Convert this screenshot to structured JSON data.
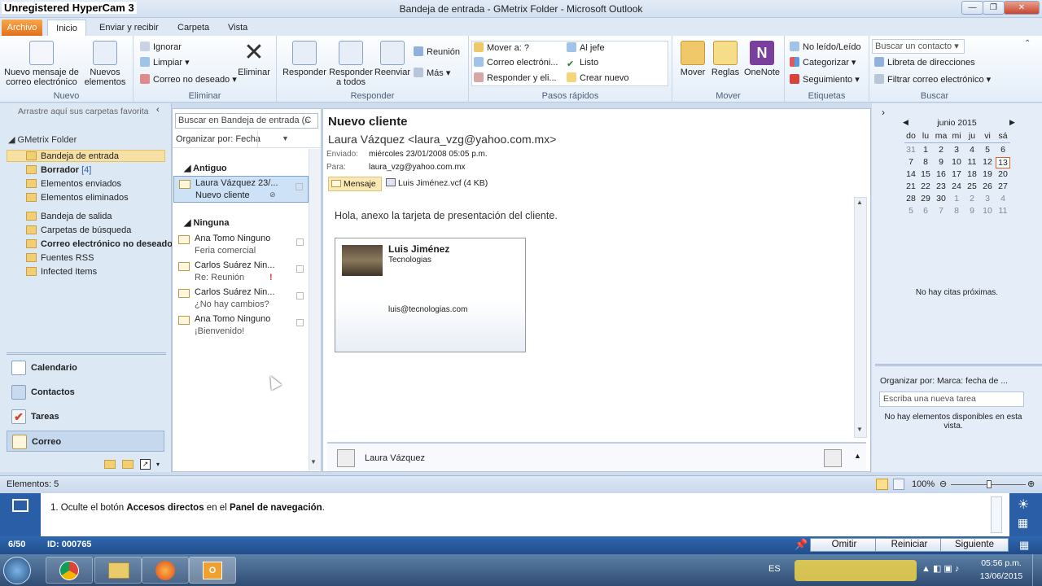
{
  "recorder_watermark": "Unregistered HyperCam 3",
  "window": {
    "title": "Bandeja de entrada - GMetrix Folder  -  Microsoft Outlook",
    "minimize": "—",
    "restore": "❐",
    "close": "✕"
  },
  "ribbon_tabs": [
    "Archivo",
    "Inicio",
    "Enviar y recibir",
    "Carpeta",
    "Vista"
  ],
  "ribbon": {
    "nuevo": {
      "label": "Nuevo",
      "new_mail": "Nuevo mensaje de correo electrónico",
      "new_items": "Nuevos elementos"
    },
    "eliminar": {
      "label": "Eliminar",
      "ignore": "Ignorar",
      "clean": "Limpiar",
      "junk": "Correo no deseado",
      "delete": "Eliminar"
    },
    "responder": {
      "label": "Responder",
      "reply": "Responder",
      "reply_all": "Responder a todos",
      "forward": "Reenviar",
      "meeting": "Reunión",
      "more": "Más"
    },
    "pasos": {
      "label": "Pasos rápidos",
      "move_to": "Mover a: ?",
      "email": "Correo electróni...",
      "reply_del": "Responder y eli...",
      "to_boss": "Al jefe",
      "done": "Listo",
      "create": "Crear nuevo"
    },
    "mover": {
      "label": "Mover",
      "move": "Mover",
      "rules": "Reglas",
      "onenote": "OneNote"
    },
    "etiquetas": {
      "label": "Etiquetas",
      "unread": "No leído/Leído",
      "categorize": "Categorizar",
      "followup": "Seguimiento"
    },
    "buscar": {
      "label": "Buscar",
      "contact_search": "Buscar un contacto",
      "address_book": "Libreta de direcciones",
      "filter": "Filtrar correo electrónico"
    }
  },
  "nav": {
    "favorites_hint": "Arrastre aquí sus carpetas favorita",
    "root": "GMetrix Folder",
    "folders": [
      "Bandeja de entrada",
      "Borrador",
      "Elementos enviados",
      "Elementos eliminados"
    ],
    "drafts_count": "[4]",
    "folders2": [
      "Bandeja de salida",
      "Carpetas de búsqueda",
      "Correo electrónico no deseado",
      "Fuentes RSS",
      "Infected Items"
    ],
    "bottom": [
      "Calendario",
      "Contactos",
      "Tareas",
      "Correo"
    ]
  },
  "list": {
    "search_placeholder": "Buscar en Bandeja de entrada (C",
    "arrange_by": "Organizar por: Fecha",
    "group_old": "Antiguo",
    "group_none": "Ninguna",
    "old_item": {
      "from": "Laura Vázquez 23/...",
      "subject": "Nuevo cliente"
    },
    "items": [
      {
        "from": "Ana Tomo  Ninguno",
        "subject": "Feria comercial"
      },
      {
        "from": "Carlos Suárez  Nin...",
        "subject": "Re: Reunión"
      },
      {
        "from": "Carlos Suárez  Nin...",
        "subject": "¿No hay cambios?"
      },
      {
        "from": "Ana Tomo  Ninguno",
        "subject": "¡Bienvenido!"
      }
    ]
  },
  "message": {
    "subject": "Nuevo cliente",
    "sender": "Laura Vázquez <laura_vzg@yahoo.com.mx>",
    "sent_label": "Enviado:",
    "sent_value": "miércoles 23/01/2008 05:05 p.m.",
    "to_label": "Para:",
    "to_value": "laura_vzg@yahoo.com.mx",
    "tab_message": "Mensaje",
    "attachment": "Luis Jiménez.vcf (4 KB)",
    "body": "Hola, anexo la tarjeta de presentación del cliente.",
    "card": {
      "name": "Luis Jiménez",
      "company": "Tecnologias",
      "email": "luis@tecnologias.com"
    },
    "people": "Laura Vázquez"
  },
  "todo": {
    "month": "junio 2015",
    "weekdays": [
      "do",
      "lu",
      "ma",
      "mi",
      "ju",
      "vi",
      "sá"
    ],
    "weeks": [
      [
        "31",
        "1",
        "2",
        "3",
        "4",
        "5",
        "6"
      ],
      [
        "7",
        "8",
        "9",
        "10",
        "11",
        "12",
        "13"
      ],
      [
        "14",
        "15",
        "16",
        "17",
        "18",
        "19",
        "20"
      ],
      [
        "21",
        "22",
        "23",
        "24",
        "25",
        "26",
        "27"
      ],
      [
        "28",
        "29",
        "30",
        "1",
        "2",
        "3",
        "4"
      ],
      [
        "5",
        "6",
        "7",
        "8",
        "9",
        "10",
        "11"
      ]
    ],
    "no_appointments": "No hay citas próximas.",
    "arrange": "Organizar por: Marca: fecha de ...",
    "new_task_placeholder": "Escriba una nueva tarea",
    "no_items": "No hay elementos disponibles en esta vista."
  },
  "status": {
    "items": "Elementos: 5",
    "zoom": "100%"
  },
  "gmetrix": {
    "step": "1.",
    "instruction_a": "Oculte el botón ",
    "instruction_b": "Accesos directos",
    "instruction_c": " en el ",
    "instruction_d": "Panel de navegación",
    "instruction_e": ".",
    "progress": "6/50",
    "id": "ID: 000765",
    "skip": "Omitir",
    "restart": "Reiniciar",
    "next": "Siguiente"
  },
  "taskbar": {
    "lang": "ES",
    "time": "05:56 p.m.",
    "date": "13/06/2015"
  },
  "colors": {
    "accent": "#2a5fa8",
    "file_tab": "#e3711b",
    "selected": "#cde1f7"
  }
}
